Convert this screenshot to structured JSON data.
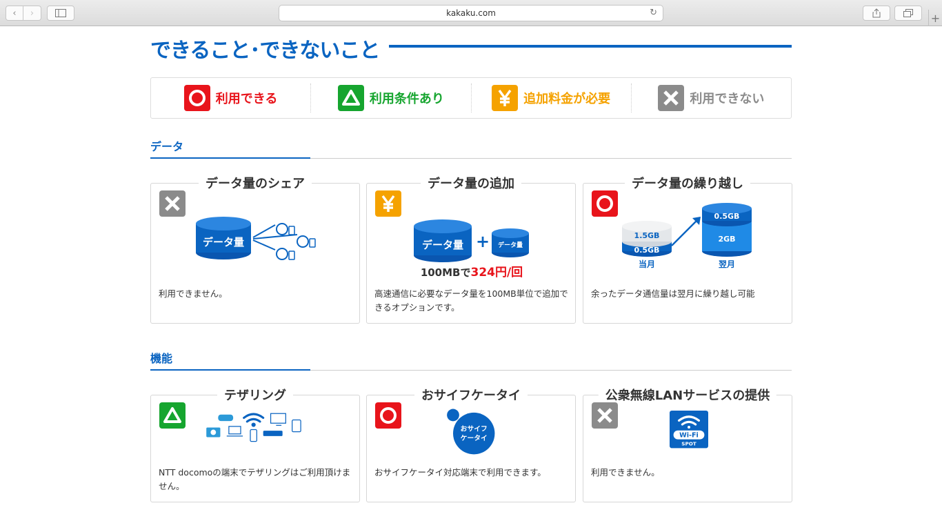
{
  "browser": {
    "url": "kakaku.com"
  },
  "page": {
    "title": "できること･できないこと",
    "legend": [
      {
        "label": "利用できる",
        "status": "ok",
        "color": "#e8141b"
      },
      {
        "label": "利用条件あり",
        "status": "conditional",
        "color": "#16a52f"
      },
      {
        "label": "追加料金が必要",
        "status": "fee",
        "color": "#f5a200"
      },
      {
        "label": "利用できない",
        "status": "ng",
        "color": "#8b8b8b"
      }
    ],
    "sections": [
      {
        "heading": "データ",
        "cards": [
          {
            "title": "データ量のシェア",
            "status": "ng",
            "desc": "利用できません。",
            "illus_label": "データ量"
          },
          {
            "title": "データ量の追加",
            "status": "fee",
            "desc": "高速通信に必要なデータ量を100MB単位で追加できるオプションです。",
            "illus_label": "データ量",
            "illus_label_small": "データ量",
            "price_prefix": "100MBで",
            "price": "324円/回"
          },
          {
            "title": "データ量の繰り越し",
            "status": "ok",
            "desc": "余ったデータ通信量は翌月に繰り越し可能",
            "this_month": "当月",
            "next_month": "翌月",
            "a_top": "1.5GB",
            "a_bot": "0.5GB",
            "b_top": "0.5GB",
            "b_bot": "2GB"
          }
        ]
      },
      {
        "heading": "機能",
        "cards": [
          {
            "title": "テザリング",
            "status": "conditional",
            "desc": "NTT docomoの端末でテザリングはご利用頂けません。"
          },
          {
            "title": "おサイフケータイ",
            "status": "ok",
            "desc": "おサイフケータイ対応端末で利用できます。",
            "illus_line1": "おサイフ",
            "illus_line2": "ケータイ"
          },
          {
            "title": "公衆無線LANサービスの提供",
            "status": "ng",
            "desc": "利用できません。",
            "wifi_label": "Wi-Fi",
            "spot_label": "SPOT"
          }
        ]
      }
    ]
  }
}
